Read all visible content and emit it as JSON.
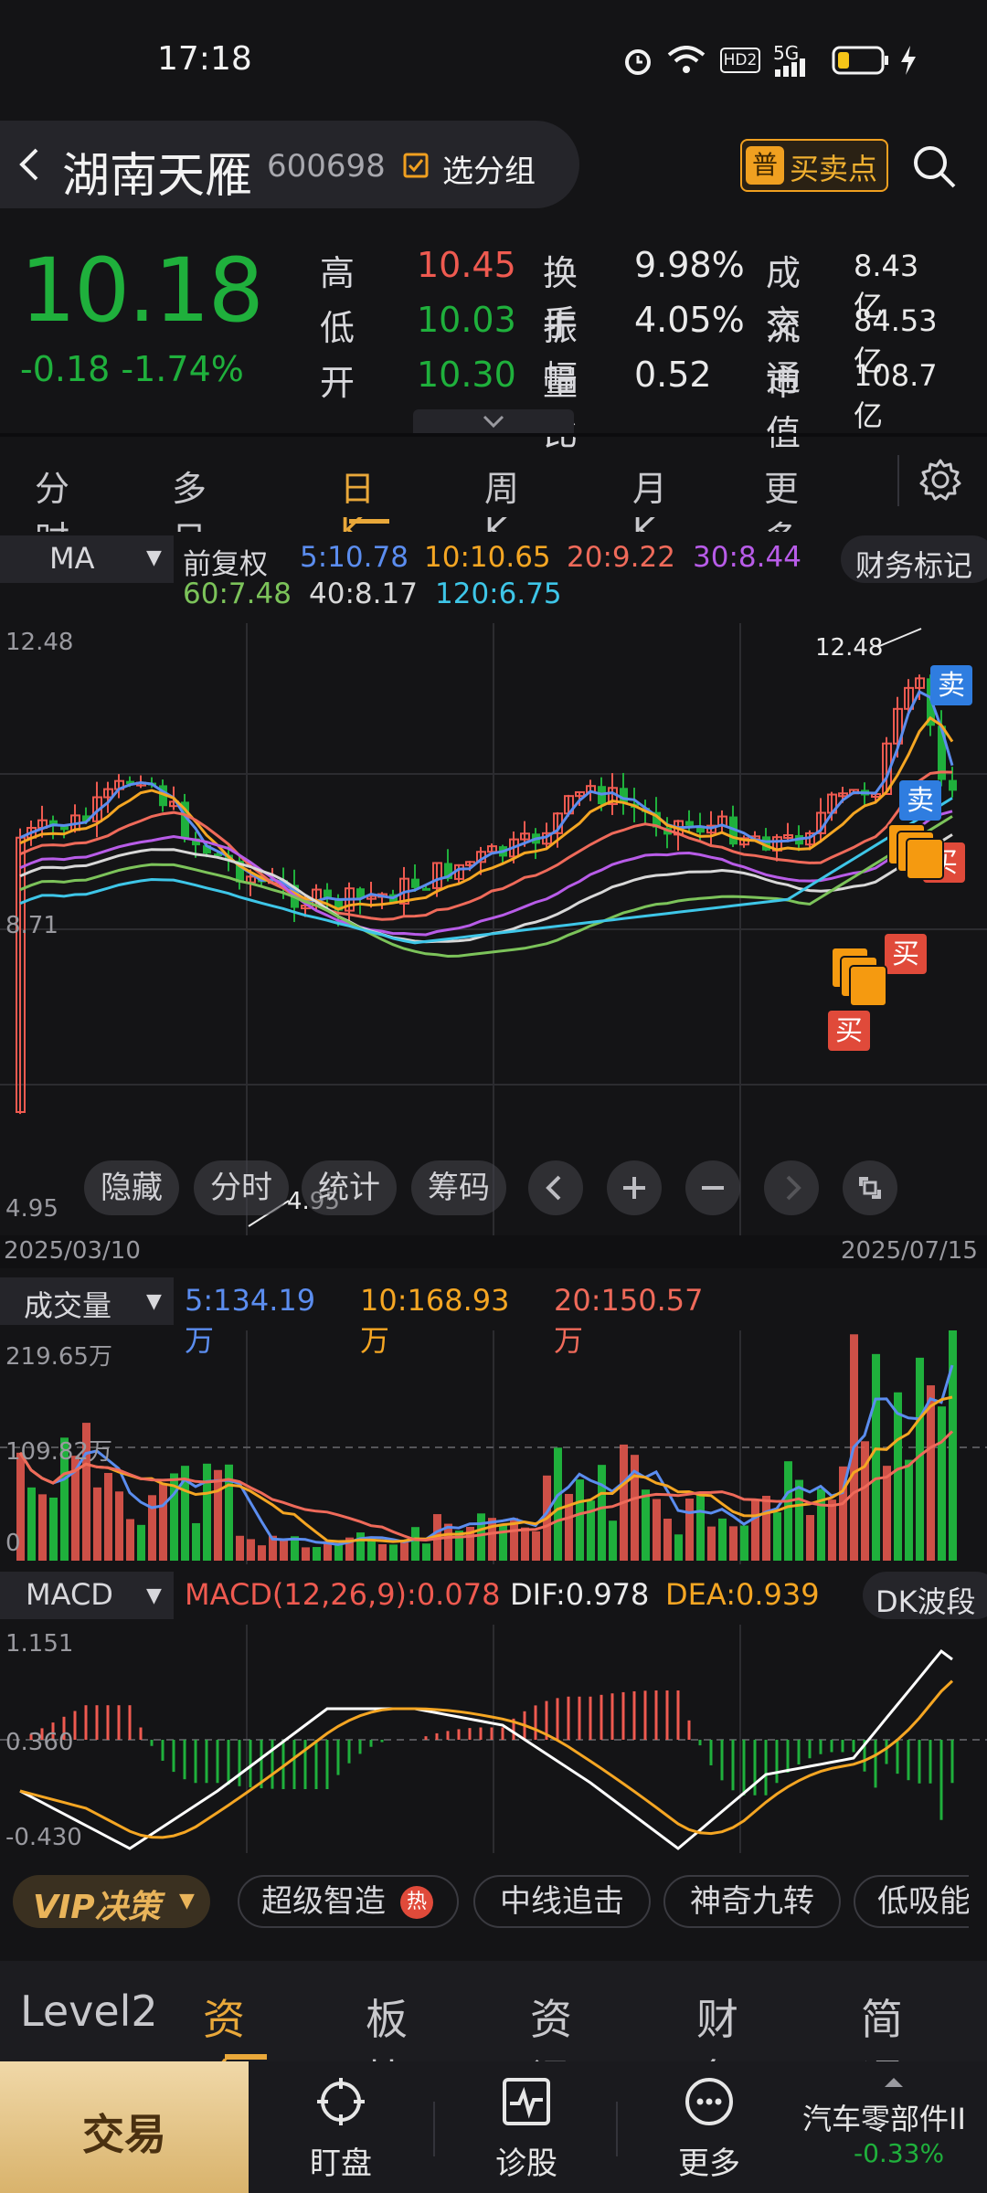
{
  "status_bar": {
    "time": "17:18",
    "network": "5G",
    "hd": "HD2"
  },
  "header": {
    "stock_name": "湖南天雁",
    "stock_code": "600698",
    "group_label": "选分组",
    "buy_sell_badge": "普",
    "buy_sell_label": "买卖点"
  },
  "quote": {
    "price": "10.18",
    "change": "-0.18",
    "change_pct": "-1.74%",
    "stats": [
      {
        "label": "高",
        "value": "10.45",
        "color": "#ef5a50"
      },
      {
        "label": "换手",
        "value": "9.98%",
        "color": "#eaeaea"
      },
      {
        "label": "成交",
        "value": "8.43亿",
        "color": "#eaeaea"
      },
      {
        "label": "低",
        "value": "10.03",
        "color": "#1fb03c"
      },
      {
        "label": "振幅",
        "value": "4.05%",
        "color": "#eaeaea"
      },
      {
        "label": "流通",
        "value": "84.53亿",
        "color": "#eaeaea"
      },
      {
        "label": "开",
        "value": "10.30",
        "color": "#1fb03c"
      },
      {
        "label": "量比",
        "value": "0.52",
        "color": "#eaeaea"
      },
      {
        "label": "市值",
        "value": "108.7亿",
        "color": "#eaeaea"
      }
    ]
  },
  "period_tabs": [
    {
      "label": "分时",
      "active": false
    },
    {
      "label": "多日▾",
      "active": false
    },
    {
      "label": "日K",
      "active": true
    },
    {
      "label": "周K",
      "active": false
    },
    {
      "label": "月K",
      "active": false
    },
    {
      "label": "更多▾",
      "active": false
    }
  ],
  "ma_indicator": {
    "select_label": "MA",
    "adjust": "前复权",
    "values": [
      {
        "text": "5:10.78",
        "color": "#5b8def"
      },
      {
        "text": "10:10.65",
        "color": "#f5a623"
      },
      {
        "text": "20:9.22",
        "color": "#ef6a5a"
      },
      {
        "text": "30:8.44",
        "color": "#b85ce8"
      },
      {
        "text": "60:7.48",
        "color": "#7cc35a"
      },
      {
        "text": "40:8.17",
        "color": "#d8d8d8"
      },
      {
        "text": "120:6.75",
        "color": "#3ec6e8"
      }
    ],
    "finance_button": "财务标记"
  },
  "candle_chart": {
    "y_top_label": "12.48",
    "y_mid_label": "8.71",
    "y_bottom_label": "4.95",
    "high_marker": "12.48",
    "low_marker": "4.95",
    "date_start": "2025/03/10",
    "date_end": "2025/07/15",
    "buy_label": "买",
    "sell_label": "卖",
    "controls": [
      "隐藏",
      "分时",
      "统计",
      "筹码"
    ]
  },
  "volume": {
    "select_label": "成交量",
    "values": [
      {
        "text": "5:134.19万",
        "color": "#5b8def"
      },
      {
        "text": "10:168.93万",
        "color": "#f5a623"
      },
      {
        "text": "20:150.57万",
        "color": "#ef6a5a"
      }
    ],
    "y_top_label": "219.65万",
    "y_mid_label": "109.82万",
    "y_bottom_label": "0"
  },
  "macd": {
    "select_label": "MACD",
    "values": [
      {
        "text": "MACD(12,26,9):0.078",
        "color": "#ef5a50"
      },
      {
        "text": "DIF:0.978",
        "color": "#eaeaea"
      },
      {
        "text": "DEA:0.939",
        "color": "#f5a623"
      }
    ],
    "dk_button": "DK波段",
    "y_top_label": "1.151",
    "y_mid_label": "0.360",
    "y_bottom_label": "-0.430"
  },
  "strategies": {
    "vip_label": "VIP决策",
    "items": [
      "超级智造",
      "中线追击",
      "神奇九转",
      "低吸能手"
    ],
    "hot_badge": "热"
  },
  "bottom_tabs": [
    {
      "label": "Level2",
      "active": false
    },
    {
      "label": "资金",
      "active": true
    },
    {
      "label": "板块",
      "active": false
    },
    {
      "label": "资讯",
      "active": false
    },
    {
      "label": "财务",
      "active": false
    },
    {
      "label": "简况",
      "active": false
    }
  ],
  "footer": {
    "trade_label": "交易",
    "items": [
      "盯盘",
      "诊股",
      "更多"
    ],
    "sector_name": "汽车零部件II",
    "sector_change": "-0.33%"
  }
}
